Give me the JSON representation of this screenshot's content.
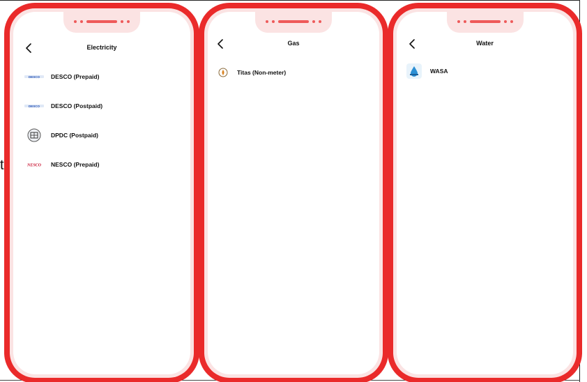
{
  "background": {
    "stray_char": "t"
  },
  "screens": [
    {
      "title": "Electricity",
      "items": [
        {
          "label": "DESCO (Prepaid)",
          "logo_icon": "desco-logo-icon"
        },
        {
          "label": "DESCO (Postpaid)",
          "logo_icon": "desco-logo-icon"
        },
        {
          "label": "DPDC (Postpaid)",
          "logo_icon": "dpdc-logo-icon"
        },
        {
          "label": "NESCO (Prepaid)",
          "logo_icon": "nesco-logo-icon"
        }
      ]
    },
    {
      "title": "Gas",
      "items": [
        {
          "label": "Titas (Non-meter)",
          "logo_icon": "titas-logo-icon"
        }
      ]
    },
    {
      "title": "Water",
      "items": [
        {
          "label": "WASA",
          "logo_icon": "wasa-logo-icon"
        }
      ]
    }
  ],
  "colors": {
    "frame": "#ea2a2a",
    "frame_inner": "#fbe3e3",
    "notch_accent": "#ee5a5a"
  }
}
